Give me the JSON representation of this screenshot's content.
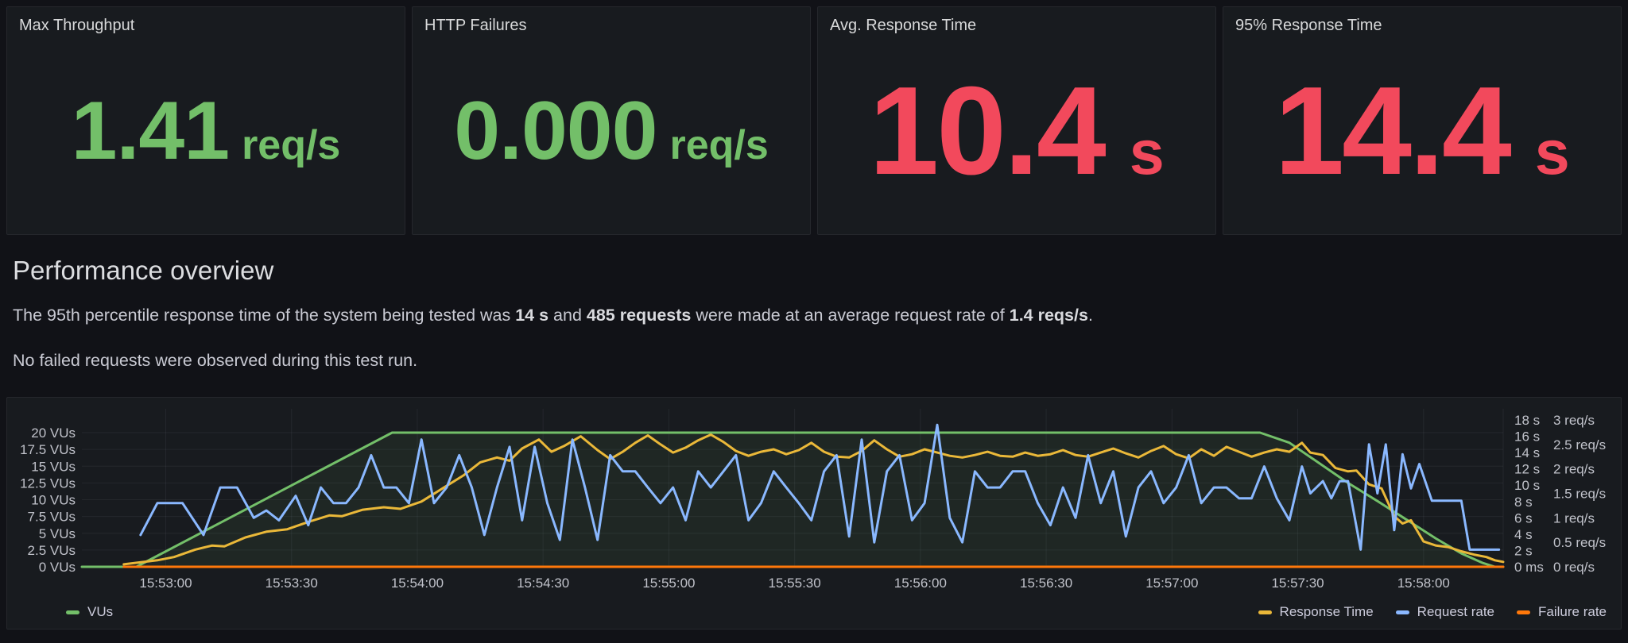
{
  "stats": [
    {
      "title": "Max Throughput",
      "value": "1.41",
      "unit": "req/s",
      "color": "#73BF69"
    },
    {
      "title": "HTTP Failures",
      "value": "0.000",
      "unit": "req/s",
      "color": "#73BF69"
    },
    {
      "title": "Avg. Response Time",
      "value": "10.4",
      "unit": "s",
      "color": "#F2495C"
    },
    {
      "title": "95% Response Time",
      "value": "14.4",
      "unit": "s",
      "color": "#F2495C"
    }
  ],
  "text_panel": {
    "heading": "Performance overview",
    "paragraph1_parts": [
      {
        "t": "The 95th percentile response time of the system being tested was "
      },
      {
        "t": "14 s",
        "b": true
      },
      {
        "t": " and "
      },
      {
        "t": "485 requests",
        "b": true
      },
      {
        "t": " were made at an average request rate of "
      },
      {
        "t": "1.4 reqs/s",
        "b": true
      },
      {
        "t": "."
      }
    ],
    "paragraph2": "No failed requests were observed during this test run."
  },
  "chart_data": {
    "type": "line",
    "title": "",
    "grid": true,
    "legend_position": "bottom",
    "time_start": "15:52:40",
    "time_end": "15:58:19",
    "t0": 0,
    "t1": 339,
    "x_ticks": [
      [
        20,
        "15:53:00"
      ],
      [
        50,
        "15:53:30"
      ],
      [
        80,
        "15:54:00"
      ],
      [
        110,
        "15:54:30"
      ],
      [
        140,
        "15:55:00"
      ],
      [
        170,
        "15:55:30"
      ],
      [
        200,
        "15:56:00"
      ],
      [
        230,
        "15:56:30"
      ],
      [
        260,
        "15:57:00"
      ],
      [
        290,
        "15:57:30"
      ],
      [
        320,
        "15:58:00"
      ]
    ],
    "y_axes": [
      {
        "id": "vus",
        "side": "left",
        "min": 0,
        "max": 20,
        "ticks": [
          [
            0,
            "0 VUs"
          ],
          [
            2.5,
            "2.5 VUs"
          ],
          [
            5,
            "5 VUs"
          ],
          [
            7.5,
            "7.5 VUs"
          ],
          [
            10,
            "10 VUs"
          ],
          [
            12.5,
            "12.5 VUs"
          ],
          [
            15,
            "15 VUs"
          ],
          [
            17.5,
            "17.5 VUs"
          ],
          [
            20,
            "20 VUs"
          ]
        ]
      },
      {
        "id": "seconds",
        "side": "right",
        "min": 0,
        "max": 18,
        "ticks": [
          [
            0,
            "0 ms"
          ],
          [
            2,
            "2 s"
          ],
          [
            4,
            "4 s"
          ],
          [
            6,
            "6 s"
          ],
          [
            8,
            "8 s"
          ],
          [
            10,
            "10 s"
          ],
          [
            12,
            "12 s"
          ],
          [
            14,
            "14 s"
          ],
          [
            16,
            "16 s"
          ],
          [
            18,
            "18 s"
          ]
        ]
      },
      {
        "id": "reqs",
        "side": "right2",
        "min": 0,
        "max": 3,
        "ticks": [
          [
            0,
            "0 req/s"
          ],
          [
            0.5,
            "0.5 req/s"
          ],
          [
            1,
            "1 req/s"
          ],
          [
            1.5,
            "1.5 req/s"
          ],
          [
            2,
            "2 req/s"
          ],
          [
            2.5,
            "2.5 req/s"
          ],
          [
            3,
            "3 req/s"
          ]
        ]
      }
    ],
    "series": [
      {
        "name": "VUs",
        "axis": "vus",
        "color": "#73BF69",
        "fill": "rgba(115,191,105,0.08)",
        "points": [
          [
            0,
            0
          ],
          [
            13,
            0
          ],
          [
            74,
            20
          ],
          [
            281,
            20
          ],
          [
            288,
            18.5
          ],
          [
            295,
            15.5
          ],
          [
            302,
            12.5
          ],
          [
            309,
            9.8
          ],
          [
            316,
            7
          ],
          [
            323,
            4.2
          ],
          [
            329,
            2
          ],
          [
            334,
            0.6
          ],
          [
            337,
            0
          ],
          [
            339,
            0
          ]
        ]
      },
      {
        "name": "Response Time",
        "axis": "seconds",
        "color": "#EAB839",
        "points": [
          [
            10,
            0.3
          ],
          [
            18,
            0.8
          ],
          [
            22,
            1.2
          ],
          [
            27,
            2.1
          ],
          [
            31,
            2.6
          ],
          [
            34,
            2.5
          ],
          [
            39,
            3.6
          ],
          [
            44,
            4.3
          ],
          [
            49,
            4.6
          ],
          [
            54,
            5.5
          ],
          [
            59,
            6.3
          ],
          [
            62,
            6.2
          ],
          [
            67,
            7.0
          ],
          [
            72,
            7.3
          ],
          [
            76,
            7.1
          ],
          [
            81,
            8.0
          ],
          [
            86,
            9.6
          ],
          [
            91,
            11.2
          ],
          [
            95,
            12.8
          ],
          [
            99,
            13.4
          ],
          [
            102,
            13.0
          ],
          [
            105,
            14.5
          ],
          [
            109,
            15.6
          ],
          [
            112,
            14.1
          ],
          [
            115,
            14.8
          ],
          [
            119,
            16.0
          ],
          [
            123,
            14.3
          ],
          [
            126,
            13.2
          ],
          [
            129,
            14.1
          ],
          [
            132,
            15.2
          ],
          [
            135,
            16.1
          ],
          [
            138,
            15.0
          ],
          [
            141,
            14.0
          ],
          [
            144,
            14.6
          ],
          [
            147,
            15.5
          ],
          [
            150,
            16.2
          ],
          [
            153,
            15.3
          ],
          [
            156,
            14.2
          ],
          [
            159,
            13.6
          ],
          [
            162,
            14.1
          ],
          [
            165,
            14.4
          ],
          [
            168,
            13.8
          ],
          [
            171,
            14.3
          ],
          [
            174,
            15.2
          ],
          [
            177,
            14.1
          ],
          [
            180,
            13.5
          ],
          [
            183,
            13.4
          ],
          [
            186,
            14.2
          ],
          [
            189,
            15.5
          ],
          [
            192,
            14.4
          ],
          [
            195,
            13.5
          ],
          [
            198,
            13.8
          ],
          [
            201,
            14.4
          ],
          [
            204,
            14.0
          ],
          [
            207,
            13.6
          ],
          [
            210,
            13.4
          ],
          [
            213,
            13.7
          ],
          [
            216,
            14.1
          ],
          [
            219,
            13.6
          ],
          [
            222,
            13.5
          ],
          [
            225,
            14.0
          ],
          [
            228,
            13.6
          ],
          [
            231,
            13.8
          ],
          [
            234,
            14.3
          ],
          [
            237,
            13.7
          ],
          [
            240,
            13.5
          ],
          [
            243,
            14.0
          ],
          [
            246,
            14.5
          ],
          [
            249,
            13.9
          ],
          [
            252,
            13.4
          ],
          [
            255,
            14.2
          ],
          [
            258,
            14.8
          ],
          [
            261,
            13.8
          ],
          [
            264,
            13.3
          ],
          [
            267,
            14.4
          ],
          [
            270,
            13.6
          ],
          [
            273,
            14.7
          ],
          [
            276,
            14.1
          ],
          [
            279,
            13.5
          ],
          [
            282,
            14.0
          ],
          [
            285,
            14.4
          ],
          [
            288,
            14.1
          ],
          [
            291,
            15.2
          ],
          [
            293,
            14.0
          ],
          [
            296,
            13.7
          ],
          [
            299,
            12.1
          ],
          [
            302,
            11.7
          ],
          [
            304,
            11.8
          ],
          [
            307,
            10.1
          ],
          [
            310,
            9.6
          ],
          [
            313,
            6.2
          ],
          [
            315,
            5.3
          ],
          [
            317,
            5.7
          ],
          [
            320,
            3.1
          ],
          [
            323,
            2.6
          ],
          [
            326,
            2.4
          ],
          [
            329,
            1.9
          ],
          [
            332,
            1.5
          ],
          [
            335,
            1.2
          ],
          [
            337,
            0.8
          ],
          [
            339,
            0.6
          ]
        ]
      },
      {
        "name": "Request rate",
        "axis": "reqs",
        "color": "#8AB8FF",
        "points": [
          [
            14,
            0.65
          ],
          [
            18,
            1.3
          ],
          [
            24,
            1.3
          ],
          [
            29,
            0.65
          ],
          [
            33,
            1.62
          ],
          [
            37,
            1.62
          ],
          [
            41,
            1.0
          ],
          [
            44,
            1.15
          ],
          [
            47,
            0.95
          ],
          [
            51,
            1.45
          ],
          [
            54,
            0.85
          ],
          [
            57,
            1.62
          ],
          [
            60,
            1.3
          ],
          [
            63,
            1.3
          ],
          [
            66,
            1.62
          ],
          [
            69,
            2.28
          ],
          [
            72,
            1.62
          ],
          [
            75,
            1.62
          ],
          [
            78,
            1.3
          ],
          [
            81,
            2.6
          ],
          [
            84,
            1.3
          ],
          [
            87,
            1.62
          ],
          [
            90,
            2.28
          ],
          [
            93,
            1.62
          ],
          [
            96,
            0.65
          ],
          [
            99,
            1.62
          ],
          [
            102,
            2.45
          ],
          [
            105,
            0.95
          ],
          [
            108,
            2.45
          ],
          [
            111,
            1.3
          ],
          [
            114,
            0.55
          ],
          [
            117,
            2.6
          ],
          [
            120,
            1.62
          ],
          [
            123,
            0.55
          ],
          [
            126,
            2.28
          ],
          [
            129,
            1.95
          ],
          [
            132,
            1.95
          ],
          [
            135,
            1.62
          ],
          [
            138,
            1.3
          ],
          [
            141,
            1.62
          ],
          [
            144,
            0.95
          ],
          [
            147,
            1.95
          ],
          [
            150,
            1.62
          ],
          [
            153,
            1.95
          ],
          [
            156,
            2.28
          ],
          [
            159,
            0.95
          ],
          [
            162,
            1.3
          ],
          [
            165,
            1.95
          ],
          [
            168,
            1.62
          ],
          [
            171,
            1.3
          ],
          [
            174,
            0.95
          ],
          [
            177,
            1.95
          ],
          [
            180,
            2.28
          ],
          [
            183,
            0.62
          ],
          [
            186,
            2.6
          ],
          [
            189,
            0.5
          ],
          [
            192,
            1.95
          ],
          [
            195,
            2.28
          ],
          [
            198,
            0.95
          ],
          [
            201,
            1.3
          ],
          [
            204,
            2.9
          ],
          [
            207,
            1.0
          ],
          [
            210,
            0.5
          ],
          [
            213,
            1.95
          ],
          [
            216,
            1.62
          ],
          [
            219,
            1.62
          ],
          [
            222,
            1.95
          ],
          [
            225,
            1.95
          ],
          [
            228,
            1.3
          ],
          [
            231,
            0.85
          ],
          [
            234,
            1.62
          ],
          [
            237,
            1.0
          ],
          [
            240,
            2.28
          ],
          [
            243,
            1.3
          ],
          [
            246,
            1.95
          ],
          [
            249,
            0.62
          ],
          [
            252,
            1.62
          ],
          [
            255,
            1.95
          ],
          [
            258,
            1.3
          ],
          [
            261,
            1.62
          ],
          [
            264,
            2.28
          ],
          [
            267,
            1.3
          ],
          [
            270,
            1.62
          ],
          [
            273,
            1.62
          ],
          [
            276,
            1.4
          ],
          [
            279,
            1.4
          ],
          [
            282,
            2.05
          ],
          [
            285,
            1.4
          ],
          [
            288,
            0.95
          ],
          [
            291,
            2.05
          ],
          [
            293,
            1.5
          ],
          [
            296,
            1.75
          ],
          [
            298,
            1.4
          ],
          [
            300,
            1.75
          ],
          [
            302,
            1.75
          ],
          [
            305,
            0.35
          ],
          [
            307,
            2.5
          ],
          [
            309,
            1.5
          ],
          [
            311,
            2.5
          ],
          [
            313,
            0.75
          ],
          [
            315,
            2.3
          ],
          [
            317,
            1.6
          ],
          [
            319,
            2.1
          ],
          [
            322,
            1.35
          ],
          [
            326,
            1.35
          ],
          [
            329,
            1.35
          ],
          [
            331,
            0.35
          ],
          [
            335,
            0.35
          ],
          [
            338,
            0.35
          ]
        ]
      },
      {
        "name": "Failure rate",
        "axis": "reqs",
        "color": "#FF780A",
        "points": [
          [
            10,
            0
          ],
          [
            339,
            0
          ]
        ]
      }
    ],
    "legend": {
      "left": [
        "VUs"
      ],
      "right": [
        "Response Time",
        "Request rate",
        "Failure rate"
      ]
    }
  }
}
